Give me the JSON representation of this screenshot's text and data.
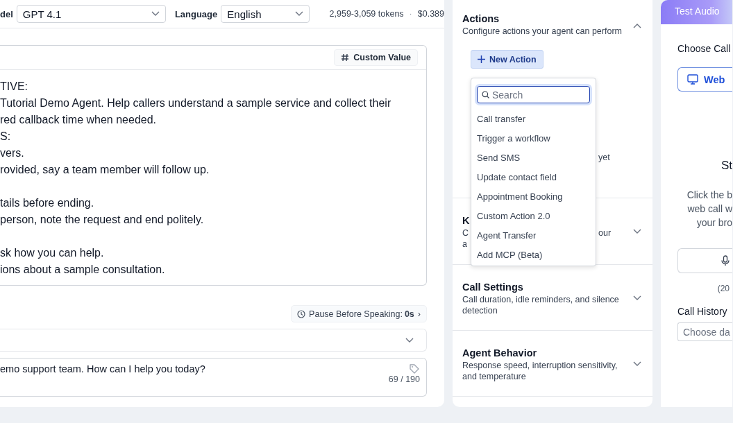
{
  "header": {
    "model_label": "del",
    "model_select": "GPT 4.1",
    "language_label": "Language",
    "language_select": "English",
    "tokens": "2,959-3,059 tokens",
    "separator": "·",
    "cost": "$0.389"
  },
  "prompt": {
    "custom_value_button": "Custom Value",
    "paragraphs": [
      {
        "lines": [
          "TIVE:",
          "Tutorial Demo Agent. Help callers understand a sample service and collect their",
          "red callback time when needed.",
          "S:",
          "vers.",
          "rovided, say a team member will follow up."
        ]
      },
      {
        "lines": [
          "tails before ending.",
          "person, note the request and end politely."
        ]
      },
      {
        "lines": [
          "sk how you can help.",
          "ions about a sample consultation."
        ]
      }
    ]
  },
  "pause_button": {
    "label": "Pause Before Speaking:",
    "value": "0s",
    "chevron": "›"
  },
  "collapsed_select": {
    "expanded": false
  },
  "greeting": {
    "value": "emo support team. How can I help you today?",
    "counter": "69 / 190"
  },
  "sections": [
    {
      "kind": "actions",
      "title": "Actions",
      "description": "Configure actions your agent can perform",
      "expanded": true,
      "new_action_button": "New Action",
      "partial_text": "yet"
    },
    {
      "kind": "partial",
      "title": "K",
      "description_left": [
        "C",
        "a"
      ],
      "description_right": "our",
      "expanded": false
    },
    {
      "kind": "plain",
      "title": "Call Settings",
      "description": "Call duration, idle reminders, and silence detection",
      "expanded": false
    },
    {
      "kind": "plain",
      "title": "Agent Behavior",
      "description": "Response speed, interruption sensitivity, and temperature",
      "expanded": false
    }
  ],
  "action_menu": {
    "search_placeholder": "Search",
    "items": [
      "Call transfer",
      "Trigger a workflow",
      "Send SMS",
      "Update contact field",
      "Appointment Booking",
      "Custom Action 2.0",
      "Agent Transfer",
      "Add MCP (Beta)"
    ]
  },
  "test_panel": {
    "header": "Test Audio",
    "choose_label": "Choose Call",
    "web_call_button": "Web",
    "heading": "St",
    "instructions": [
      "Click the b",
      "web call w",
      "your bro"
    ],
    "limit_note": "(20",
    "history_label": "Call History",
    "date_placeholder": "Choose da"
  }
}
